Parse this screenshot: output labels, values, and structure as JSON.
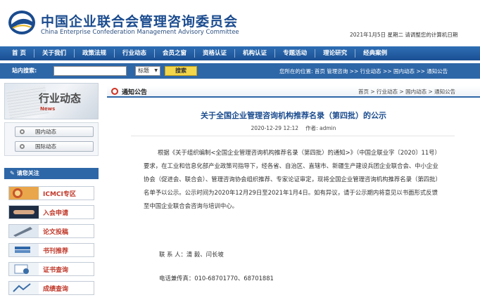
{
  "header": {
    "title": "中国企业联合会管理咨询委员会",
    "subtitle": "China Enterprise Confederation Management Advisory Committee",
    "date_text": "2021年1月5日 星期二  请调整您的计算机日期"
  },
  "nav": {
    "items": [
      "首  页",
      "关于我们",
      "政策法规",
      "行业动态",
      "会员之窗",
      "资格认证",
      "机构认证",
      "专题活动",
      "理论研究",
      "经典案例"
    ]
  },
  "search": {
    "label": "站内搜索:",
    "select_value": "标题",
    "button": "搜索",
    "breadcrumb": "您所在的位置: 首页 管理咨询 >> 行业动态 >> 国内动态 >> 通知公告"
  },
  "sidebar": {
    "banner_title": "行业动态",
    "banner_sub": "News",
    "menu": [
      "国内动态",
      "国际动态"
    ],
    "attention_title": "请您关注",
    "links": [
      {
        "label": "ICMCI专区",
        "icon": "globe-thumbnail"
      },
      {
        "label": "入会申请",
        "icon": "handshake-thumbnail"
      },
      {
        "label": "论文投稿",
        "icon": "pen-thumbnail"
      },
      {
        "label": "书刊推荐",
        "icon": "book-thumbnail"
      },
      {
        "label": "证书查询",
        "icon": "certificate-thumbnail"
      },
      {
        "label": "成绩查询",
        "icon": "chart-thumbnail"
      }
    ]
  },
  "content": {
    "section_title": "通知公告",
    "crumbs": "首页 > 行业动态 > 国内动态 > 通知公告",
    "article_title": "关于全国企业管理咨询机构推荐名录（第四批）的公示",
    "date": "2020-12-29 12:12",
    "author": "作者: admin",
    "body": "根据《关于组织编制<全国企业管理咨询机构推荐名录（第四批）的通知>》（中国企联业字〔2020〕11号）要求，在工业和信息化部产业政策司指导下，经各省、自治区、直辖市、新疆生产建设兵团企业联合会、中小企业协会（促进会、联合会）、管理咨询协会组织推荐、专家论证审定，现将全国企业管理咨询机构推荐名录（第四批）名单予以公示。公示时间为2020年12月29日至2021年1月4日。如有异议，请于公示期内将意见以书面形式反馈至中国企业联合会咨询与培训中心。",
    "contact": "联 系 人：清 毅、闫长坡",
    "phone": "电话兼传真：010-68701770、68701881"
  },
  "colors": {
    "brand": "#1a4b8e",
    "nav": "#2f6fb5",
    "accent_red": "#c0392b"
  }
}
